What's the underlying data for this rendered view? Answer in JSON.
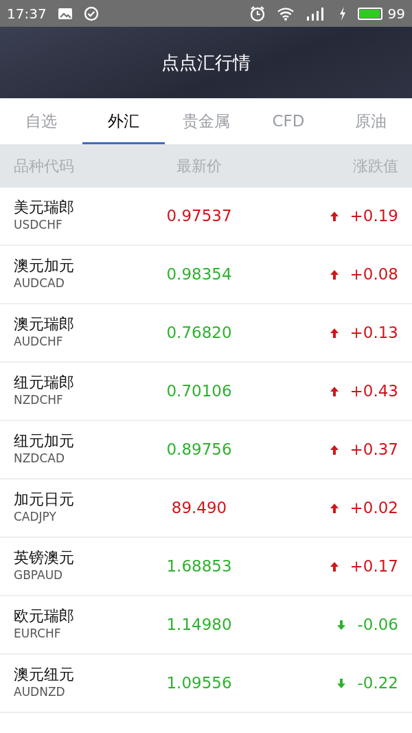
{
  "status_bar": {
    "time": "17:37",
    "battery": "99"
  },
  "header": {
    "title": "点点汇行情"
  },
  "tabs": [
    {
      "label": "自选",
      "selected": false
    },
    {
      "label": "外汇",
      "selected": true
    },
    {
      "label": "贵金属",
      "selected": false
    },
    {
      "label": "CFD",
      "selected": false
    },
    {
      "label": "原油",
      "selected": false
    }
  ],
  "table": {
    "columns": [
      "品种代码",
      "最新价",
      "涨跌值"
    ],
    "rows": [
      {
        "name": "美元瑞郎",
        "code": "USDCHF",
        "price": "0.97537",
        "color": "#d0161b",
        "kind": "up",
        "change": "+0.19"
      },
      {
        "name": "澳元加元",
        "code": "AUDCAD",
        "price": "0.98354",
        "color": "#2fb12f",
        "kind": "up",
        "change": "+0.08"
      },
      {
        "name": "澳元瑞郎",
        "code": "AUDCHF",
        "price": "0.76820",
        "color": "#2fb12f",
        "kind": "up",
        "change": "+0.13"
      },
      {
        "name": "纽元瑞郎",
        "code": "NZDCHF",
        "price": "0.70106",
        "color": "#2fb12f",
        "kind": "up",
        "change": "+0.43"
      },
      {
        "name": "纽元加元",
        "code": "NZDCAD",
        "price": "0.89756",
        "color": "#2fb12f",
        "kind": "up",
        "change": "+0.37"
      },
      {
        "name": "加元日元",
        "code": "CADJPY",
        "price": "89.490",
        "color": "#d0161b",
        "kind": "up",
        "change": "+0.02"
      },
      {
        "name": "英镑澳元",
        "code": "GBPAUD",
        "price": "1.68853",
        "color": "#2fb12f",
        "kind": "up",
        "change": "+0.17"
      },
      {
        "name": "欧元瑞郎",
        "code": "EURCHF",
        "price": "1.14980",
        "color": "#2fb12f",
        "kind": "down",
        "change": "-0.06"
      },
      {
        "name": "澳元纽元",
        "code": "AUDNZD",
        "price": "1.09556",
        "color": "#2fb12f",
        "kind": "down",
        "change": "-0.22"
      }
    ]
  }
}
